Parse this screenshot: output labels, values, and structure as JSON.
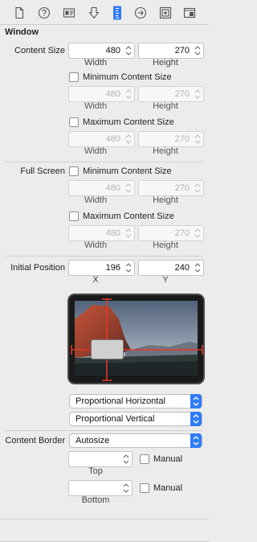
{
  "toolbar": {
    "icons": [
      "file-icon",
      "help-icon",
      "identity-icon",
      "attributes-icon",
      "size-ruler-icon",
      "connections-arrow-icon",
      "bindings-icon",
      "effects-icon"
    ],
    "active": "size-ruler-icon",
    "accent": "#2f7cf6"
  },
  "window": {
    "title": "Window",
    "content_size": {
      "label": "Content Size",
      "width": "480",
      "height": "270",
      "width_caption": "Width",
      "height_caption": "Height"
    },
    "minimum": {
      "label": "Minimum Content Size",
      "width": "480",
      "height": "270",
      "width_caption": "Width",
      "height_caption": "Height"
    },
    "maximum": {
      "label": "Maximum Content Size",
      "width": "480",
      "height": "270",
      "width_caption": "Width",
      "height_caption": "Height"
    }
  },
  "full_screen": {
    "label": "Full Screen",
    "minimum": {
      "label": "Minimum Content Size",
      "width": "480",
      "height": "270",
      "width_caption": "Width",
      "height_caption": "Height"
    },
    "maximum": {
      "label": "Maximum Content Size",
      "width": "480",
      "height": "270",
      "width_caption": "Width",
      "height_caption": "Height"
    }
  },
  "initial_position": {
    "label": "Initial Position",
    "x": "196",
    "y": "240",
    "x_caption": "X",
    "y_caption": "Y",
    "horizontal": "Proportional Horizontal",
    "vertical": "Proportional Vertical"
  },
  "content_border": {
    "label": "Content Border",
    "mode": "Autosize",
    "top_value": "",
    "top_caption": "Top",
    "top_manual": "Manual",
    "bottom_value": "",
    "bottom_caption": "Bottom",
    "bottom_manual": "Manual"
  }
}
